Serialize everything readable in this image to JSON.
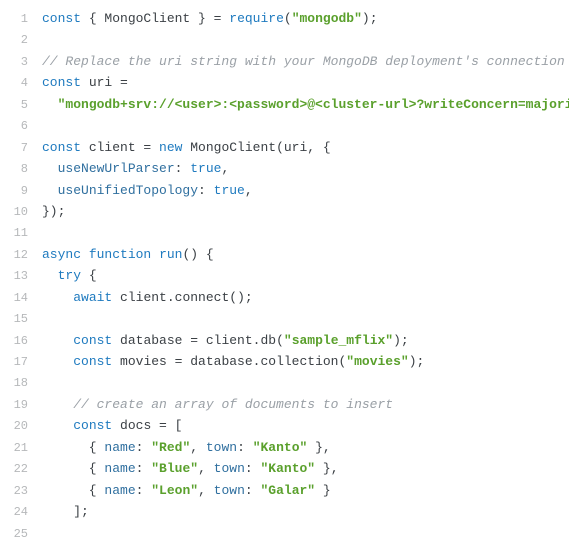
{
  "lines": [
    {
      "n": "1",
      "segs": [
        {
          "t": "const",
          "c": "kw"
        },
        {
          "t": " { ",
          "c": "op"
        },
        {
          "t": "MongoClient",
          "c": "cls"
        },
        {
          "t": " } = ",
          "c": "op"
        },
        {
          "t": "require",
          "c": "fn"
        },
        {
          "t": "(",
          "c": "op"
        },
        {
          "t": "\"mongodb\"",
          "c": "reqstr"
        },
        {
          "t": ");",
          "c": "op"
        }
      ]
    },
    {
      "n": "2",
      "segs": []
    },
    {
      "n": "3",
      "segs": [
        {
          "t": "// Replace the uri string with your MongoDB deployment's connection string.",
          "c": "cmt"
        }
      ]
    },
    {
      "n": "4",
      "segs": [
        {
          "t": "const",
          "c": "kw"
        },
        {
          "t": " uri =",
          "c": "op"
        }
      ]
    },
    {
      "n": "5",
      "segs": [
        {
          "t": "  ",
          "c": "op"
        },
        {
          "t": "\"mongodb+srv://<user>:<password>@<cluster-url>?writeConcern=majority\"",
          "c": "reqstr"
        },
        {
          "t": ";",
          "c": "op"
        }
      ]
    },
    {
      "n": "6",
      "segs": []
    },
    {
      "n": "7",
      "segs": [
        {
          "t": "const",
          "c": "kw"
        },
        {
          "t": " client = ",
          "c": "op"
        },
        {
          "t": "new",
          "c": "kw"
        },
        {
          "t": " ",
          "c": "op"
        },
        {
          "t": "MongoClient",
          "c": "cls"
        },
        {
          "t": "(uri, {",
          "c": "op"
        }
      ]
    },
    {
      "n": "8",
      "segs": [
        {
          "t": "  ",
          "c": "op"
        },
        {
          "t": "useNewUrlParser",
          "c": "prop"
        },
        {
          "t": ": ",
          "c": "op"
        },
        {
          "t": "true",
          "c": "bool"
        },
        {
          "t": ",",
          "c": "op"
        }
      ]
    },
    {
      "n": "9",
      "segs": [
        {
          "t": "  ",
          "c": "op"
        },
        {
          "t": "useUnifiedTopology",
          "c": "prop"
        },
        {
          "t": ": ",
          "c": "op"
        },
        {
          "t": "true",
          "c": "bool"
        },
        {
          "t": ",",
          "c": "op"
        }
      ]
    },
    {
      "n": "10",
      "segs": [
        {
          "t": "});",
          "c": "op"
        }
      ]
    },
    {
      "n": "11",
      "segs": []
    },
    {
      "n": "12",
      "segs": [
        {
          "t": "async",
          "c": "kw"
        },
        {
          "t": " ",
          "c": "op"
        },
        {
          "t": "function",
          "c": "kw"
        },
        {
          "t": " ",
          "c": "op"
        },
        {
          "t": "run",
          "c": "fn"
        },
        {
          "t": "() {",
          "c": "op"
        }
      ]
    },
    {
      "n": "13",
      "segs": [
        {
          "t": "  ",
          "c": "op"
        },
        {
          "t": "try",
          "c": "kw"
        },
        {
          "t": " {",
          "c": "op"
        }
      ]
    },
    {
      "n": "14",
      "segs": [
        {
          "t": "    ",
          "c": "op"
        },
        {
          "t": "await",
          "c": "kw"
        },
        {
          "t": " client.",
          "c": "op"
        },
        {
          "t": "connect",
          "c": "cls"
        },
        {
          "t": "();",
          "c": "op"
        }
      ]
    },
    {
      "n": "15",
      "segs": []
    },
    {
      "n": "16",
      "segs": [
        {
          "t": "    ",
          "c": "op"
        },
        {
          "t": "const",
          "c": "kw"
        },
        {
          "t": " database = client.",
          "c": "op"
        },
        {
          "t": "db",
          "c": "cls"
        },
        {
          "t": "(",
          "c": "op"
        },
        {
          "t": "\"sample_mflix\"",
          "c": "reqstr"
        },
        {
          "t": ");",
          "c": "op"
        }
      ]
    },
    {
      "n": "17",
      "segs": [
        {
          "t": "    ",
          "c": "op"
        },
        {
          "t": "const",
          "c": "kw"
        },
        {
          "t": " movies = database.",
          "c": "op"
        },
        {
          "t": "collection",
          "c": "cls"
        },
        {
          "t": "(",
          "c": "op"
        },
        {
          "t": "\"movies\"",
          "c": "reqstr"
        },
        {
          "t": ");",
          "c": "op"
        }
      ]
    },
    {
      "n": "18",
      "segs": []
    },
    {
      "n": "19",
      "segs": [
        {
          "t": "    ",
          "c": "op"
        },
        {
          "t": "// create an array of documents to insert",
          "c": "cmt"
        }
      ]
    },
    {
      "n": "20",
      "segs": [
        {
          "t": "    ",
          "c": "op"
        },
        {
          "t": "const",
          "c": "kw"
        },
        {
          "t": " docs = [",
          "c": "op"
        }
      ]
    },
    {
      "n": "21",
      "segs": [
        {
          "t": "      { ",
          "c": "op"
        },
        {
          "t": "name",
          "c": "prop"
        },
        {
          "t": ": ",
          "c": "op"
        },
        {
          "t": "\"Red\"",
          "c": "reqstr"
        },
        {
          "t": ", ",
          "c": "op"
        },
        {
          "t": "town",
          "c": "prop"
        },
        {
          "t": ": ",
          "c": "op"
        },
        {
          "t": "\"Kanto\"",
          "c": "reqstr"
        },
        {
          "t": " },",
          "c": "op"
        }
      ]
    },
    {
      "n": "22",
      "segs": [
        {
          "t": "      { ",
          "c": "op"
        },
        {
          "t": "name",
          "c": "prop"
        },
        {
          "t": ": ",
          "c": "op"
        },
        {
          "t": "\"Blue\"",
          "c": "reqstr"
        },
        {
          "t": ", ",
          "c": "op"
        },
        {
          "t": "town",
          "c": "prop"
        },
        {
          "t": ": ",
          "c": "op"
        },
        {
          "t": "\"Kanto\"",
          "c": "reqstr"
        },
        {
          "t": " },",
          "c": "op"
        }
      ]
    },
    {
      "n": "23",
      "segs": [
        {
          "t": "      { ",
          "c": "op"
        },
        {
          "t": "name",
          "c": "prop"
        },
        {
          "t": ": ",
          "c": "op"
        },
        {
          "t": "\"Leon\"",
          "c": "reqstr"
        },
        {
          "t": ", ",
          "c": "op"
        },
        {
          "t": "town",
          "c": "prop"
        },
        {
          "t": ": ",
          "c": "op"
        },
        {
          "t": "\"Galar\"",
          "c": "reqstr"
        },
        {
          "t": " }",
          "c": "op"
        }
      ]
    },
    {
      "n": "24",
      "segs": [
        {
          "t": "    ];",
          "c": "op"
        }
      ]
    },
    {
      "n": "25",
      "segs": []
    }
  ]
}
